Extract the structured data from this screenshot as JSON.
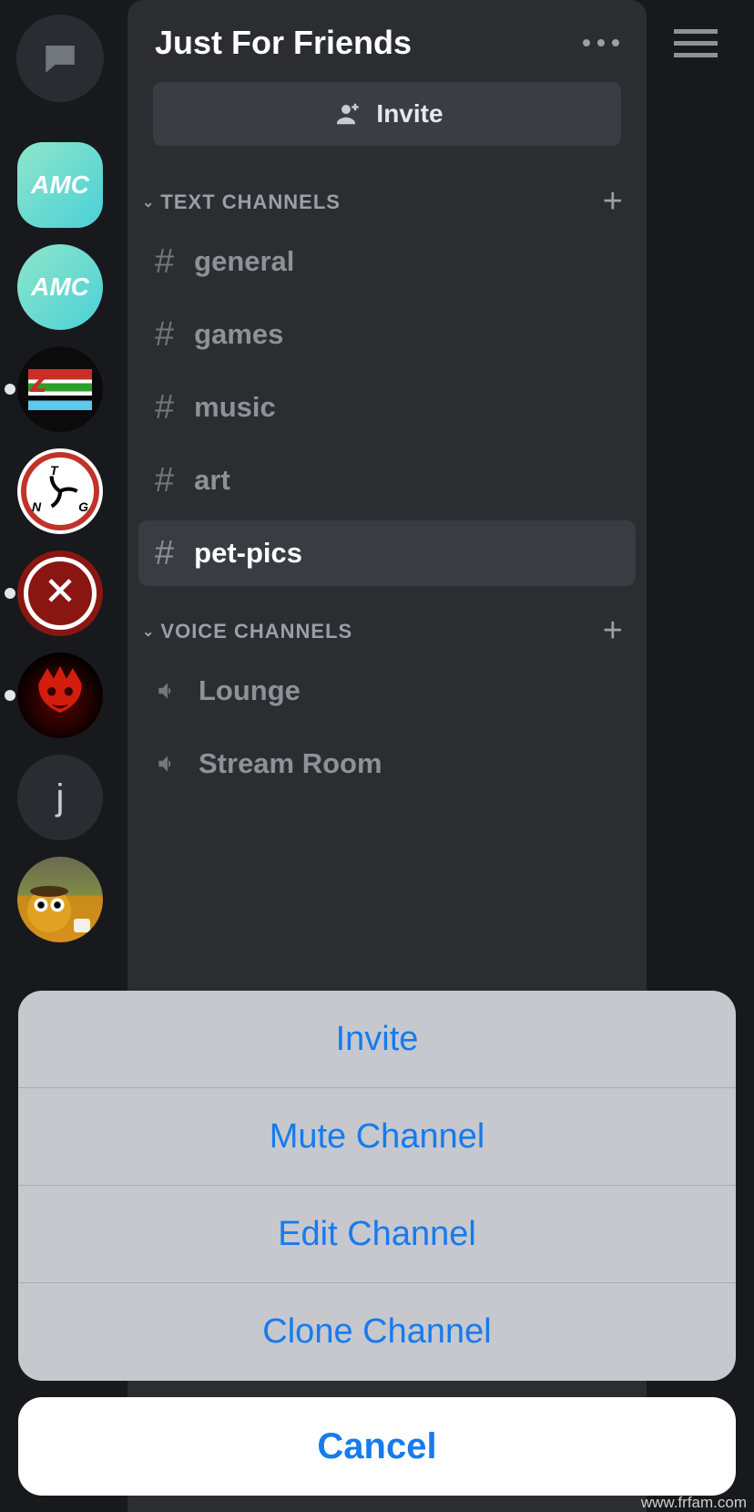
{
  "server_rail": {
    "dm_label": "Direct Messages",
    "servers": [
      {
        "name": "amc-active",
        "label": "AMC"
      },
      {
        "name": "amc",
        "label": "AMC"
      },
      {
        "name": "z-server",
        "label": "z"
      },
      {
        "name": "tng-server",
        "label": "TNG"
      },
      {
        "name": "crest-server",
        "label": "✕"
      },
      {
        "name": "bowser-server",
        "label": ""
      },
      {
        "name": "j-server",
        "label": "j"
      },
      {
        "name": "dog-server",
        "label": ""
      }
    ]
  },
  "header": {
    "server_name": "Just For Friends"
  },
  "invite_button": "Invite",
  "categories": {
    "text": {
      "label": "TEXT CHANNELS"
    },
    "voice": {
      "label": "VOICE CHANNELS"
    }
  },
  "text_channels": [
    {
      "name": "general"
    },
    {
      "name": "games"
    },
    {
      "name": "music"
    },
    {
      "name": "art"
    },
    {
      "name": "pet-pics",
      "active": true
    }
  ],
  "voice_channels": [
    {
      "name": "Lounge"
    },
    {
      "name": "Stream Room"
    }
  ],
  "action_sheet": {
    "items": [
      "Invite",
      "Mute Channel",
      "Edit Channel",
      "Clone Channel"
    ],
    "cancel": "Cancel"
  },
  "watermark": "www.frfam.com"
}
